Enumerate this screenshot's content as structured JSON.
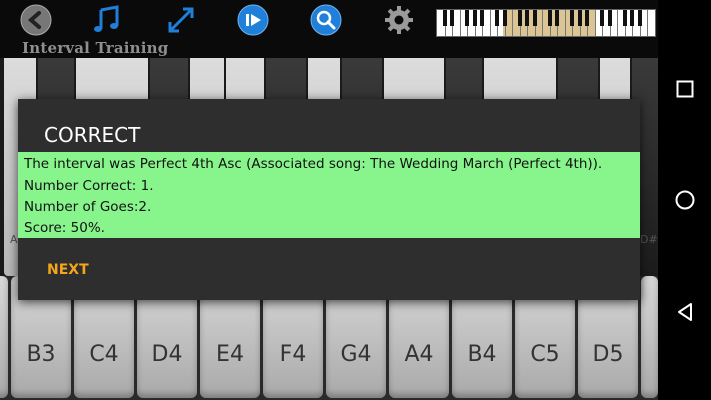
{
  "app": {
    "title": "Interval Training",
    "toolbar": [
      {
        "name": "back-button",
        "icon": "back-arrow-icon"
      },
      {
        "name": "music-note-button",
        "icon": "music-note-icon"
      },
      {
        "name": "expand-button",
        "icon": "expand-arrows-icon"
      },
      {
        "name": "play-button",
        "icon": "play-icon"
      },
      {
        "name": "search-button",
        "icon": "search-icon"
      },
      {
        "name": "settings-button",
        "icon": "gear-icon"
      }
    ],
    "upper_keyboard": {
      "partial_labels": [
        "A",
        "D#"
      ]
    },
    "lower_keyboard": {
      "keys": [
        "B3",
        "C4",
        "D4",
        "E4",
        "F4",
        "G4",
        "A4",
        "B4",
        "C5",
        "D5"
      ]
    }
  },
  "dialog": {
    "title": "CORRECT",
    "lines": [
      "The interval was Perfect 4th Asc (Associated song: The Wedding March (Perfect 4th)).",
      "Number Correct: 1.",
      "Number of Goes:2.",
      "Score: 50%."
    ],
    "next_label": "NEXT"
  },
  "navbar": {
    "buttons": [
      "recents-icon",
      "home-icon",
      "back-icon"
    ]
  },
  "colors": {
    "dialog_body": "#87f58c",
    "accent": "#f4a51c"
  }
}
